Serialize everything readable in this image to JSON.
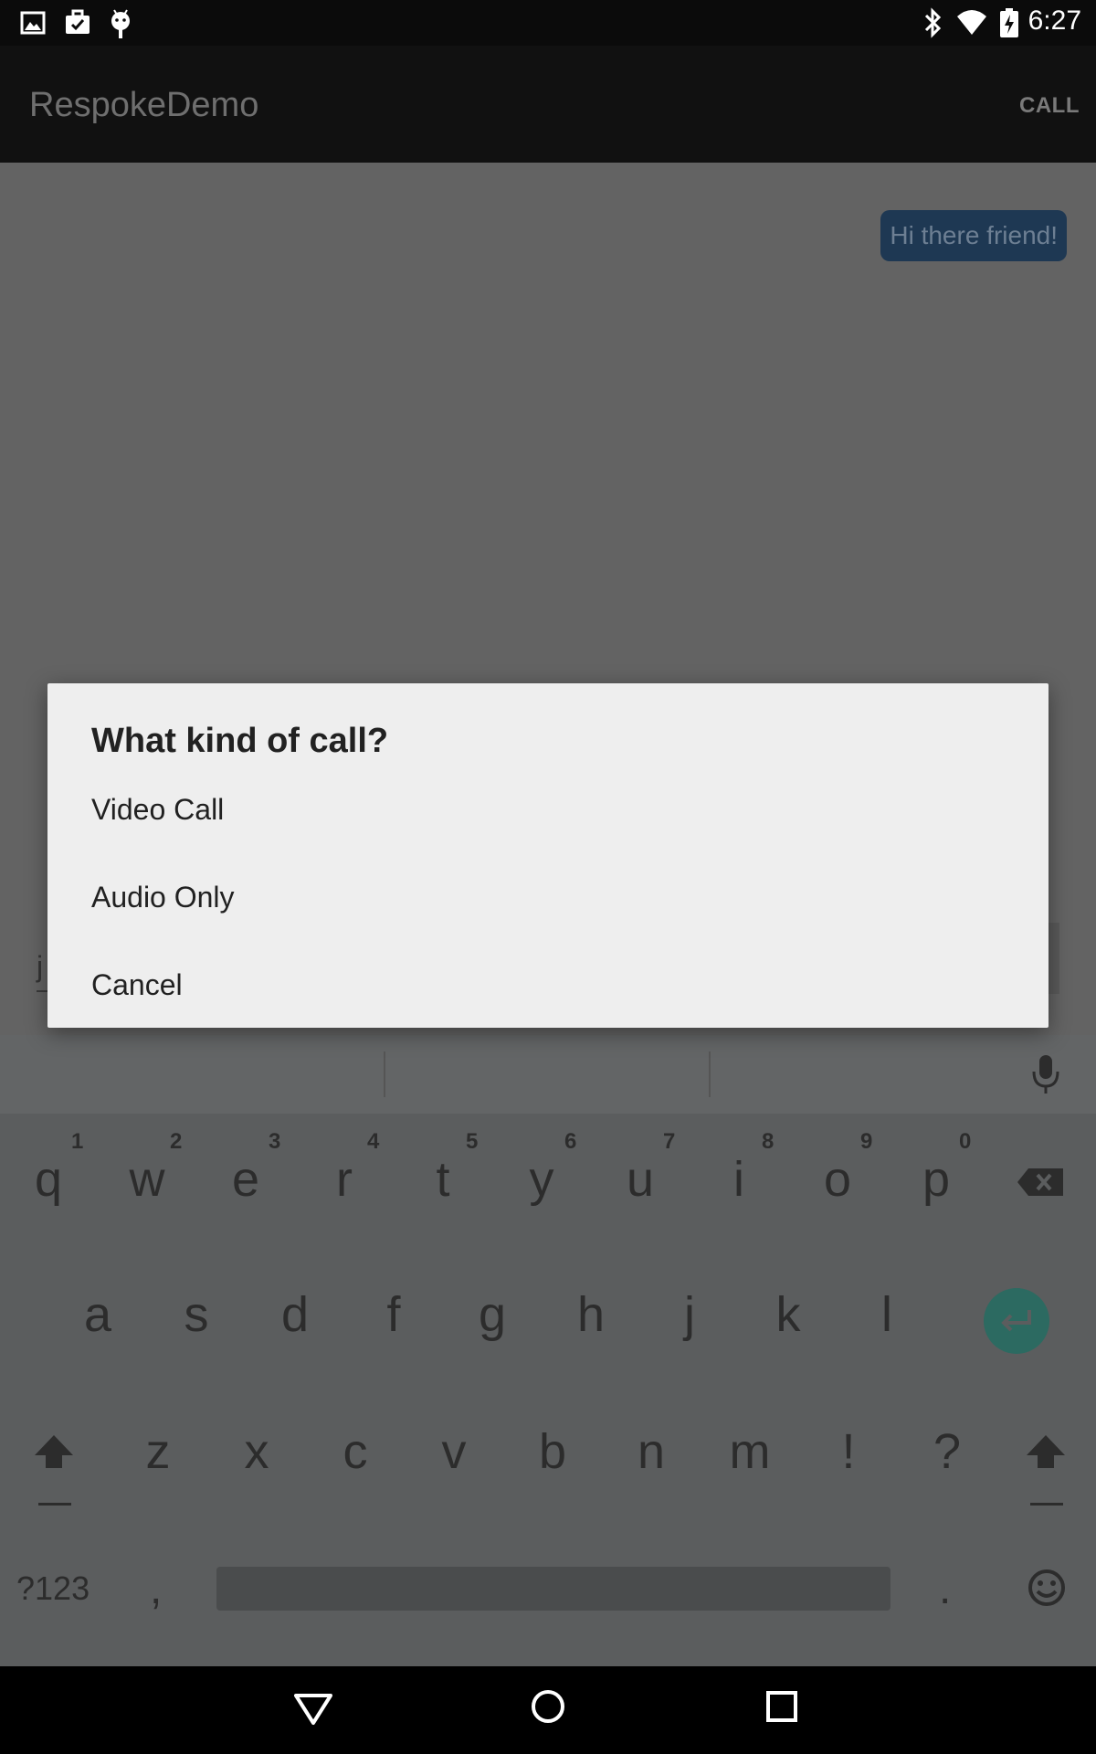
{
  "status_bar": {
    "time": "6:27"
  },
  "app_bar": {
    "title": "RespokeDemo",
    "call_action": "CALL"
  },
  "chat": {
    "message": "Hi there friend!",
    "input_peek": "j"
  },
  "dialog": {
    "title": "What kind of call?",
    "options": [
      "Video Call",
      "Audio Only",
      "Cancel"
    ]
  },
  "keyboard": {
    "row1": [
      "q",
      "w",
      "e",
      "r",
      "t",
      "y",
      "u",
      "i",
      "o",
      "p"
    ],
    "row1_hints": [
      "1",
      "2",
      "3",
      "4",
      "5",
      "6",
      "7",
      "8",
      "9",
      "0"
    ],
    "row2": [
      "a",
      "s",
      "d",
      "f",
      "g",
      "h",
      "j",
      "k",
      "l"
    ],
    "row3": [
      "z",
      "x",
      "c",
      "v",
      "b",
      "n",
      "m",
      "!",
      "?"
    ],
    "symbols_key": "?123",
    "comma": ",",
    "period": ".",
    "icons": [
      "backspace-icon",
      "enter-icon",
      "shift-icon",
      "mic-icon",
      "emoji-icon"
    ]
  },
  "nav_bar": {
    "icons": [
      "back-icon",
      "home-icon",
      "recents-icon"
    ]
  },
  "colors": {
    "dialog_bg": "#eeeeee",
    "bubble_bg": "#1e3853",
    "enter_key": "#2c6a61",
    "scrim": "#636363"
  }
}
